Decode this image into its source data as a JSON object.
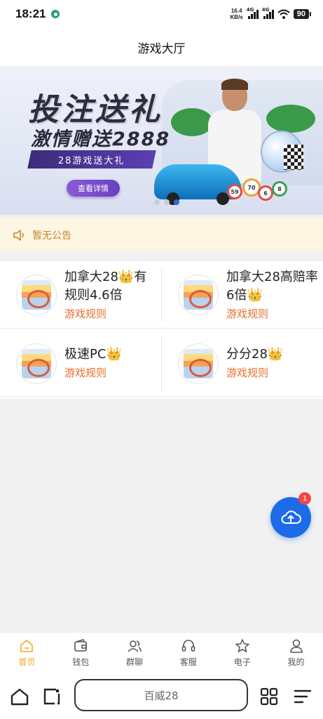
{
  "status_bar": {
    "time": "18:21",
    "net_speed_value": "16.4",
    "net_speed_unit": "KB/s",
    "signal_1_label": "4G",
    "signal_2_label": "4G",
    "battery": "90"
  },
  "header": {
    "title": "游戏大厅"
  },
  "banner": {
    "title": "投注送礼",
    "subtitle": "激情赠送2888",
    "ribbon": "28游戏送大礼",
    "button": "查看详情",
    "ball_numbers": [
      "59",
      "70",
      "6",
      "8"
    ],
    "active_slide": 3,
    "slide_count": 3
  },
  "notice": {
    "text": "暂无公告"
  },
  "games": [
    {
      "name": "加拿大28",
      "name_tail": "有规则4.6倍",
      "rule": "游戏规则"
    },
    {
      "name": "加拿大28高赔率6倍",
      "name_tail": "",
      "rule": "游戏规则"
    },
    {
      "name": "极速PC",
      "name_tail": "",
      "rule": "游戏规则"
    },
    {
      "name": "分分28",
      "name_tail": "",
      "rule": "游戏规则"
    }
  ],
  "fab": {
    "badge": "1"
  },
  "tabbar": {
    "items": [
      {
        "label": "首页",
        "icon": "home-icon",
        "active": true
      },
      {
        "label": "钱包",
        "icon": "wallet-icon",
        "active": false
      },
      {
        "label": "群聊",
        "icon": "group-chat-icon",
        "active": false
      },
      {
        "label": "客服",
        "icon": "headset-icon",
        "active": false
      },
      {
        "label": "电子",
        "icon": "star-icon",
        "active": false
      },
      {
        "label": "我的",
        "icon": "user-icon",
        "active": false
      }
    ],
    "active_color": "#f5a623"
  },
  "system_nav": {
    "url_text": "百威28"
  },
  "colors": {
    "accent": "#f5a623",
    "rule_text": "#e86e2c",
    "fab": "#1c6be8",
    "notice_bg": "#fdf6e2",
    "notice_text": "#c8862b"
  }
}
